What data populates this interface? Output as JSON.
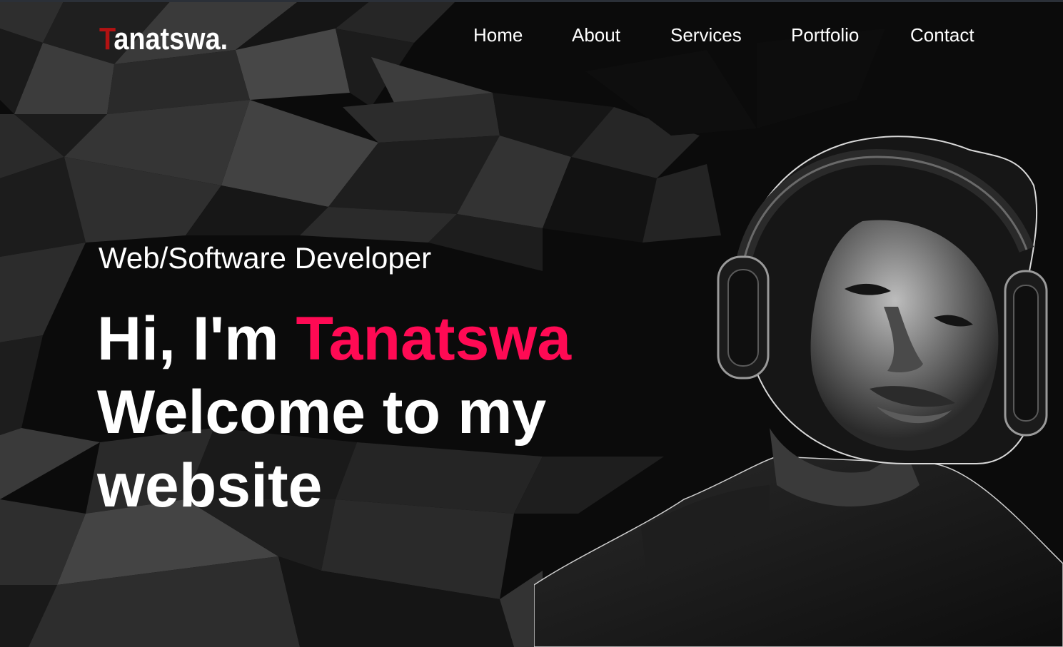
{
  "brand": {
    "logo_first_letter": "T",
    "logo_rest": "anatswa",
    "logo_dot": ".",
    "logo_first_color": "#b31212"
  },
  "nav": {
    "items": [
      {
        "label": "Home"
      },
      {
        "label": "About"
      },
      {
        "label": "Services"
      },
      {
        "label": "Portfolio"
      },
      {
        "label": "Contact"
      }
    ]
  },
  "hero": {
    "subtitle": "Web/Software Developer",
    "greeting": "Hi, I'm ",
    "name": "Tanatswa",
    "line2": "Welcome to my",
    "line3": "website",
    "accent_color": "#ff0a54"
  },
  "colors": {
    "background": "#0b0b0b",
    "text": "#ffffff",
    "accent": "#ff0a54"
  }
}
